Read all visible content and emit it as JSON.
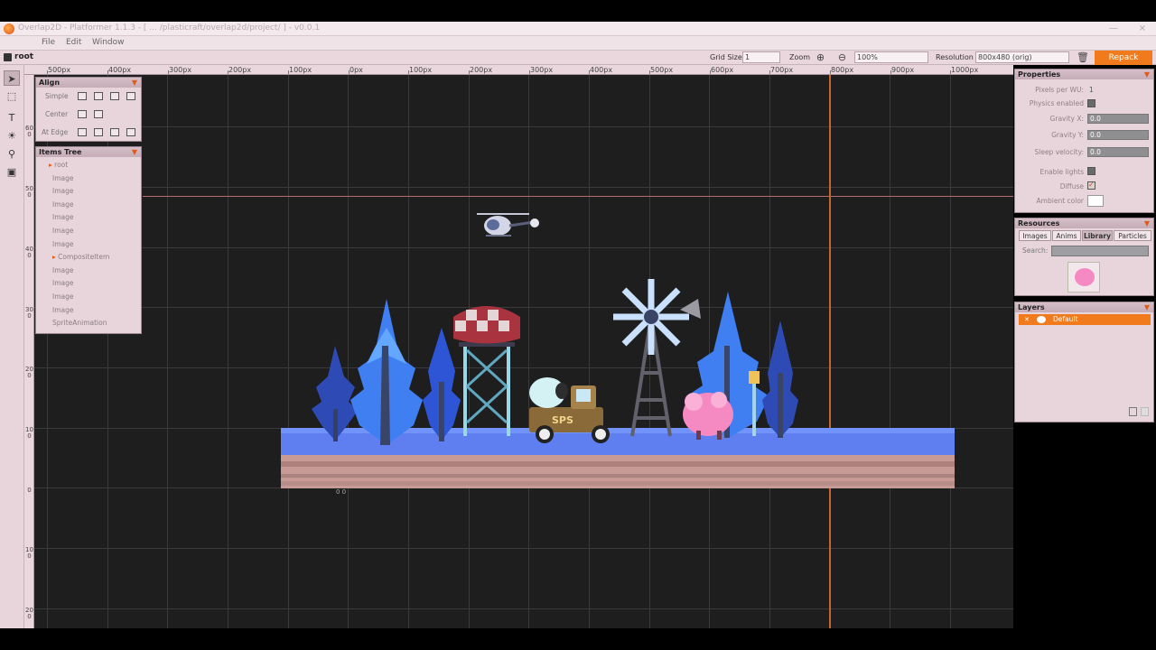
{
  "window": {
    "title": "Overlap2D - Platformer 1.1.3 - [ ... /plasticraft/overlap2d/project/ ] - v0.0.1",
    "minimize": "—",
    "close": "×"
  },
  "menu": {
    "file": "File",
    "edit": "Edit",
    "window": "Window"
  },
  "toolbar": {
    "root": "root",
    "grid_size_label": "Grid Size",
    "grid_size_value": "1",
    "zoom_label": "Zoom",
    "zoom_value": "100%",
    "resolution_label": "Resolution",
    "resolution_value": "800x480 (orig)",
    "repack": "Repack"
  },
  "ruler": {
    "top": [
      "500px",
      "400px",
      "300px",
      "200px",
      "100px",
      "0px",
      "100px",
      "200px",
      "300px",
      "400px",
      "500px",
      "600px",
      "700px",
      "800px",
      "900px",
      "1000px"
    ],
    "left": [
      "600",
      "500",
      "400",
      "300",
      "200",
      "100",
      "0",
      "100",
      "200"
    ]
  },
  "canvas": {
    "origin_label": "0 0"
  },
  "align_panel": {
    "title": "Align",
    "simple_label": "Simple",
    "center_label": "Center",
    "at_edge_label": "At Edge"
  },
  "items_tree": {
    "title": "Items Tree",
    "items": [
      "root",
      "Image",
      "Image",
      "Image",
      "Image",
      "Image",
      "Image",
      "CompositeItem",
      "Image",
      "Image",
      "Image",
      "Image",
      "SpriteAnimation"
    ]
  },
  "properties": {
    "title": "Properties",
    "pixels_per_wu_label": "Pixels per WU:",
    "pixels_per_wu_value": "1",
    "physics_enabled_label": "Physics enabled",
    "gravity_x_label": "Gravity X:",
    "gravity_x_value": "0.0",
    "gravity_y_label": "Gravity Y:",
    "gravity_y_value": "0.0",
    "sleep_velocity_label": "Sleep velocity:",
    "sleep_velocity_value": "0.0",
    "enable_lights_label": "Enable lights",
    "diffuse_label": "Diffuse",
    "ambient_color_label": "Ambient color"
  },
  "resources": {
    "title": "Resources",
    "tabs": [
      "Images",
      "Anims",
      "Library",
      "Particles"
    ],
    "search_label": "Search:"
  },
  "layers": {
    "title": "Layers",
    "items": [
      "Default"
    ]
  },
  "colors": {
    "accent": "#f07a1c",
    "canvas_bg": "#1e1e1f",
    "panel_bg": "#e8d5dc",
    "ground_top": "#5f7ff0",
    "ground_soil": "#c89a95",
    "tree_blue": "#3f7ff2",
    "sheep_pink": "#f58ac3"
  }
}
